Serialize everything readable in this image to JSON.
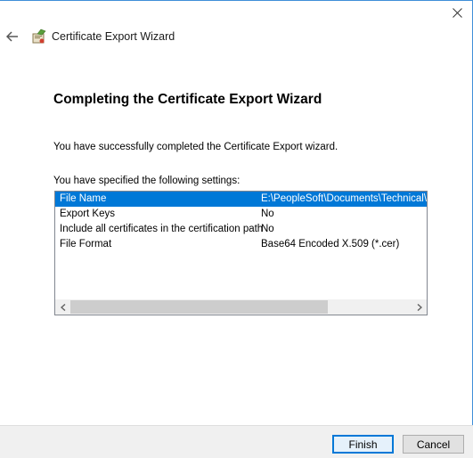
{
  "window": {
    "title": "Certificate Export Wizard"
  },
  "page": {
    "heading": "Completing the Certificate Export Wizard",
    "success_message": "You have successfully completed the Certificate Export wizard.",
    "settings_label": "You have specified the following settings:"
  },
  "settings": [
    {
      "name": "File Name",
      "value": "E:\\PeopleSoft\\Documents\\Technical\\Go",
      "selected": true
    },
    {
      "name": "Export Keys",
      "value": "No",
      "selected": false
    },
    {
      "name": "Include all certificates in the certification path",
      "value": "No",
      "selected": false
    },
    {
      "name": "File Format",
      "value": "Base64 Encoded X.509 (*.cer)",
      "selected": false
    }
  ],
  "buttons": {
    "finish": "Finish",
    "cancel": "Cancel"
  },
  "icons": {
    "close": "close-icon",
    "back": "back-arrow-icon",
    "wizard": "certificate-wizard-icon",
    "scroll_left": "chevron-left-icon",
    "scroll_right": "chevron-right-icon"
  },
  "colors": {
    "selection": "#0078d7",
    "accent_border": "#3f8fd8"
  }
}
